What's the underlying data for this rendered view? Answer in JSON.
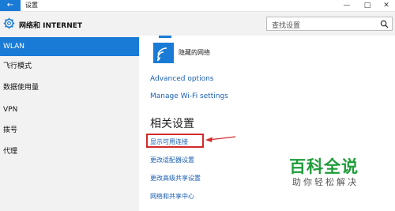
{
  "window": {
    "title": "设置",
    "back_icon": "←",
    "minimize": "—",
    "maximize": "□",
    "close": "✕"
  },
  "header": {
    "title": "网络和 INTERNET",
    "search_placeholder": "查找设置"
  },
  "sidebar": {
    "items": [
      {
        "label": "WLAN",
        "active": true
      },
      {
        "label": "飞行模式"
      },
      {
        "label": "数据使用量"
      },
      {
        "label": "VPN"
      },
      {
        "label": "拨号"
      },
      {
        "label": "代理"
      }
    ]
  },
  "main": {
    "hidden_network": "隐藏的网络",
    "advanced_options": "Advanced options",
    "manage_wifi": "Manage Wi-Fi settings",
    "related_title": "相关设置",
    "related_links": [
      "显示可用连接",
      "更改适配器设置",
      "更改高级共享设置",
      "网络和共享中心"
    ]
  },
  "watermark": {
    "title": "百科全说",
    "subtitle": "助你轻松解决"
  },
  "colors": {
    "accent": "#1a7bd6",
    "link": "#1a5fb4",
    "highlight": "#d32a2a",
    "watermark": "#1f9d3a"
  }
}
